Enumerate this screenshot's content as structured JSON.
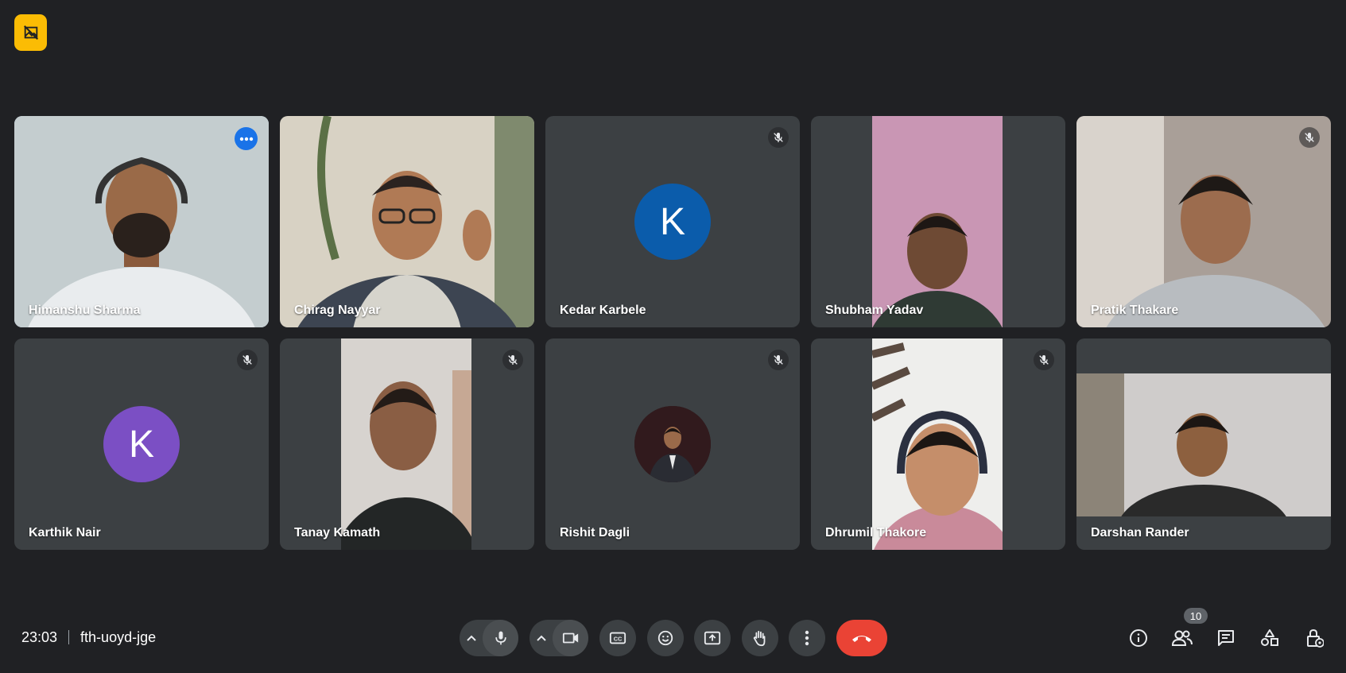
{
  "meeting": {
    "time": "23:03",
    "code": "fth-uoyd-jge"
  },
  "participants": [
    {
      "name": "Himanshu Sharma",
      "muted": false,
      "video": true,
      "active": true
    },
    {
      "name": "Chirag Nayyar",
      "muted": false,
      "video": true
    },
    {
      "name": "Kedar Karbele",
      "muted": true,
      "video": false,
      "avatar_letter": "K",
      "avatar_color": "#0b5cab"
    },
    {
      "name": "Shubham Yadav",
      "muted": false,
      "video": true
    },
    {
      "name": "Pratik Thakare",
      "muted": true,
      "video": true
    },
    {
      "name": "Karthik Nair",
      "muted": true,
      "video": false,
      "avatar_letter": "K",
      "avatar_color": "#7b4fc4"
    },
    {
      "name": "Tanay Kamath",
      "muted": true,
      "video": true
    },
    {
      "name": "Rishit Dagli",
      "muted": true,
      "video": false,
      "avatar_photo": true
    },
    {
      "name": "Dhrumil Thakore",
      "muted": true,
      "video": true
    },
    {
      "name": "Darshan Rander",
      "muted": false,
      "video": true
    }
  ],
  "toolbar": {
    "participant_count": "10",
    "icons": [
      "mic-icon",
      "camera-icon",
      "captions-icon",
      "emoji-icon",
      "present-icon",
      "raise-hand-icon",
      "more-options-icon",
      "end-call-icon"
    ],
    "right_icons": [
      "info-icon",
      "people-icon",
      "chat-icon",
      "activities-icon",
      "host-controls-icon"
    ]
  },
  "colors": {
    "background": "#202124",
    "tile": "#3c4043",
    "accent": "#1a73e8",
    "leave": "#ea4335",
    "badge": "#fbbc04"
  }
}
